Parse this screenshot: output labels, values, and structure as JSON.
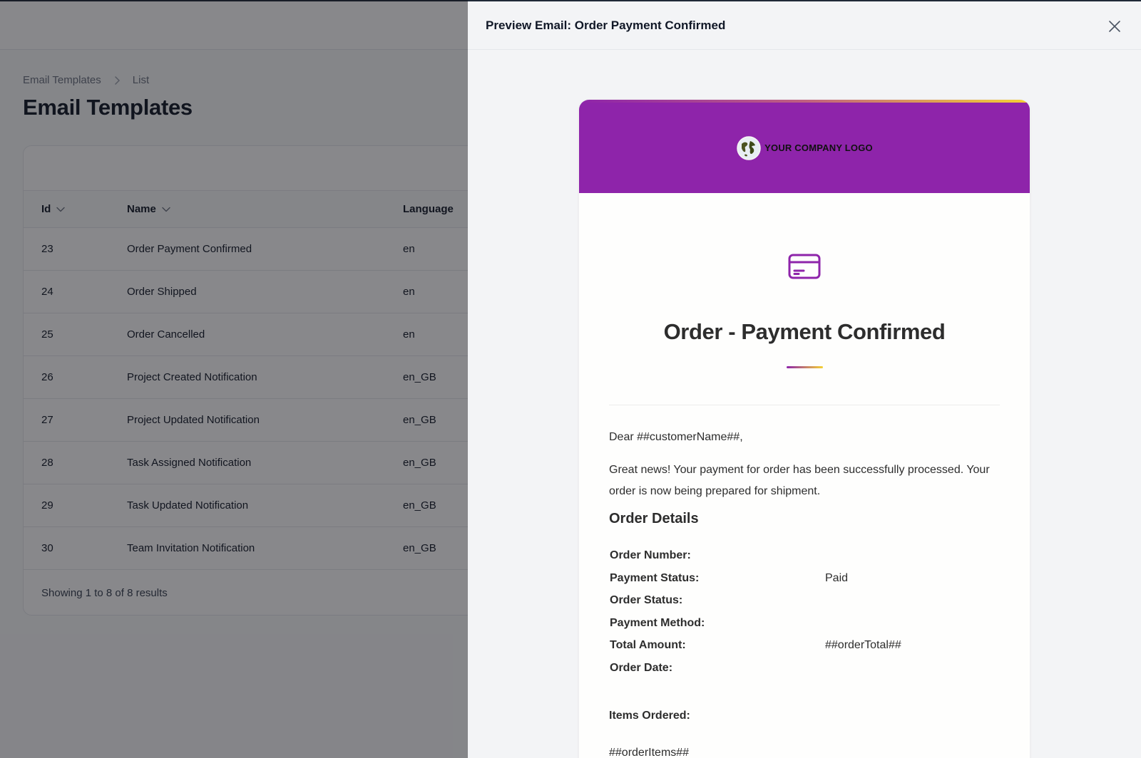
{
  "breadcrumb": {
    "root": "Email Templates",
    "current": "List"
  },
  "page_title": "Email Templates",
  "table": {
    "columns": {
      "id": "Id",
      "name": "Name",
      "language": "Language"
    },
    "rows": [
      {
        "id": "23",
        "name": "Order Payment Confirmed",
        "language": "en"
      },
      {
        "id": "24",
        "name": "Order Shipped",
        "language": "en"
      },
      {
        "id": "25",
        "name": "Order Cancelled",
        "language": "en"
      },
      {
        "id": "26",
        "name": "Project Created Notification",
        "language": "en_GB"
      },
      {
        "id": "27",
        "name": "Project Updated Notification",
        "language": "en_GB"
      },
      {
        "id": "28",
        "name": "Task Assigned Notification",
        "language": "en_GB"
      },
      {
        "id": "29",
        "name": "Task Updated Notification",
        "language": "en_GB"
      },
      {
        "id": "30",
        "name": "Team Invitation Notification",
        "language": "en_GB"
      }
    ],
    "footer": "Showing 1 to 8 of 8 results"
  },
  "panel": {
    "title": "Preview Email: Order Payment Confirmed",
    "close_icon": "close-icon"
  },
  "email": {
    "logo_text": "YOUR COMPANY LOGO",
    "title": "Order - Payment Confirmed",
    "greeting": "Dear ##customerName##,",
    "message": "Great news! Your payment for order has been successfully processed. Your order is now being prepared for shipment.",
    "details_heading": "Order Details",
    "details": [
      {
        "label": "Order Number:",
        "value": ""
      },
      {
        "label": "Payment Status:",
        "value": "Paid"
      },
      {
        "label": "Order Status:",
        "value": ""
      },
      {
        "label": "Payment Method:",
        "value": ""
      },
      {
        "label": "Total Amount:",
        "value": "##orderTotal##"
      },
      {
        "label": "Order Date:",
        "value": ""
      }
    ],
    "items_heading": "Items Ordered:",
    "items_value": "##orderItems##"
  },
  "colors": {
    "brand_purple": "#8e24aa",
    "accent_yellow": "#f5d233",
    "overlay": "#808082"
  }
}
